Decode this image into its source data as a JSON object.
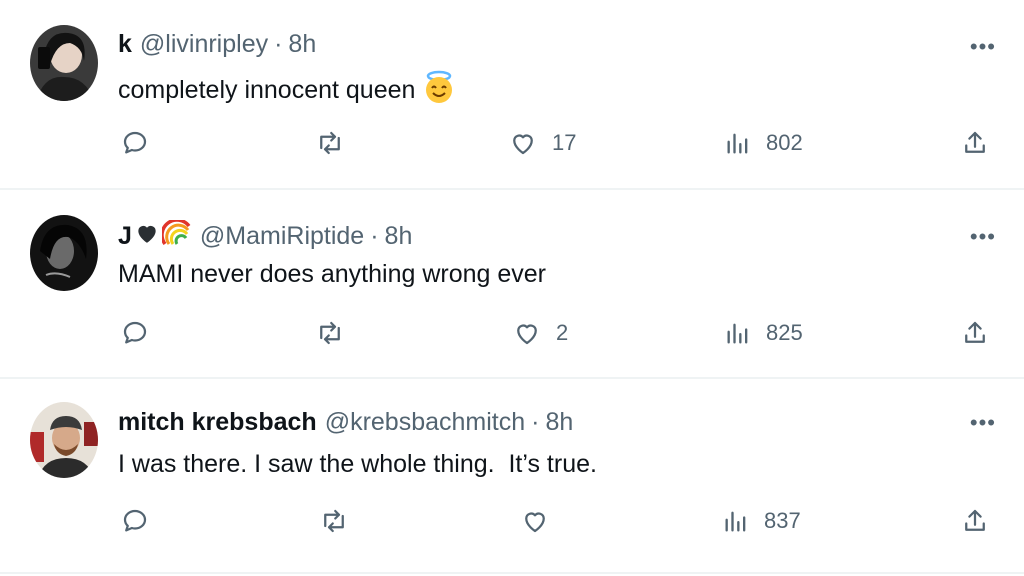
{
  "tweets": [
    {
      "name": "k",
      "handle": "@livinripley",
      "separator": "·",
      "time": "8h",
      "text": "completely innocent queen",
      "text_emoji": "smiling-face-with-halo",
      "avatar_bg": "#2b2b2b",
      "counts": {
        "reply": "",
        "retweet": "",
        "like": "17",
        "views": "802"
      }
    },
    {
      "name": "J",
      "name_emojis": [
        "black-heart",
        "rainbow"
      ],
      "handle": "@MamiRiptide",
      "separator": "·",
      "time": "8h",
      "text": "MAMI never does anything wrong ever",
      "avatar_bg": "#1a1a1a",
      "counts": {
        "reply": "",
        "retweet": "",
        "like": "2",
        "views": "825"
      }
    },
    {
      "name": "mitch krebsbach",
      "handle": "@krebsbachmitch",
      "separator": "·",
      "time": "8h",
      "text": "I was there. I saw the whole thing.  It’s true.",
      "avatar_bg": "#d9d2c7",
      "counts": {
        "reply": "",
        "retweet": "",
        "like": "",
        "views": "837"
      }
    }
  ],
  "more_label": "•••",
  "colors": {
    "text": "#0f1419",
    "muted": "#536471",
    "divider": "#eff3f4"
  }
}
